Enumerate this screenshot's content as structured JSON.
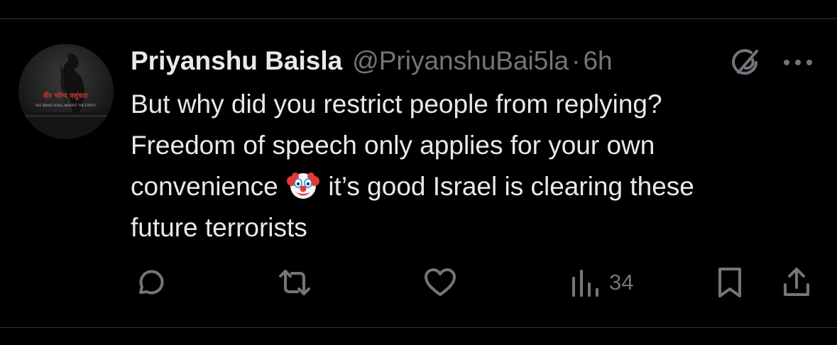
{
  "tweet": {
    "display_name": "Priyanshu Baisla",
    "handle": "@PriyanshuBai5la",
    "separator": "·",
    "time": "6h",
    "text": {
      "line1": "But why did you restrict people from replying?",
      "line2": "Freedom of speech only applies for your own",
      "line3_before_emoji": "convenience ",
      "line3_after_emoji": " it’s good Israel is clearing these",
      "line4": "future terrorists"
    },
    "emoji": "clown-face"
  },
  "avatar": {
    "devanagari_text": "वीर भोग्य वसुंधरा",
    "subtitle": "THE BRAVE SHALL INHERIT THE EARTH"
  },
  "actions": {
    "reply_icon": "reply-icon",
    "retweet_icon": "retweet-icon",
    "like_icon": "like-icon",
    "views_icon": "views-icon",
    "views_count": "34",
    "bookmark_icon": "bookmark-icon",
    "share_icon": "share-icon"
  },
  "colors": {
    "background": "#000000",
    "primary_text": "#e7e9ea",
    "secondary_text": "#71767b",
    "avatar_text_red": "#c0392b"
  }
}
